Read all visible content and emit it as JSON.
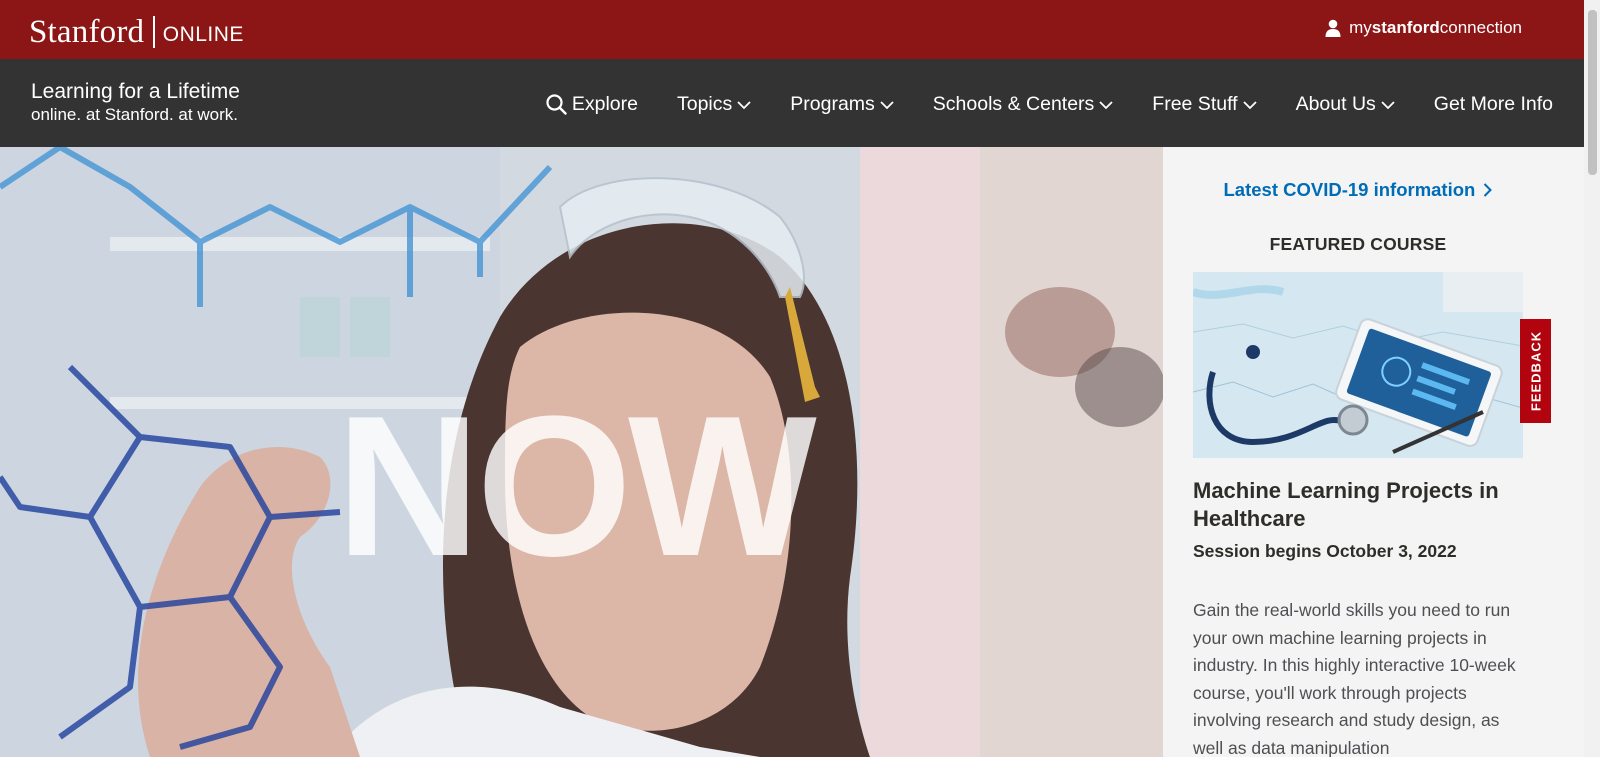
{
  "header": {
    "brand_name": "Stanford",
    "brand_suffix": "ONLINE",
    "account_link": {
      "prefix": "my",
      "bold": "stanford",
      "suffix": "connection",
      "icon": "user-icon"
    },
    "colors": {
      "cardinal": "#8c1515",
      "nav_bg": "#333333"
    }
  },
  "nav": {
    "tagline_title": "Learning for a Lifetime",
    "tagline_sub": "online. at Stanford. at work.",
    "items": [
      {
        "label": "Explore",
        "icon": "search-icon"
      },
      {
        "label": "Topics",
        "icon": "chevron-down-icon"
      },
      {
        "label": "Programs",
        "icon": "chevron-down-icon"
      },
      {
        "label": "Schools & Centers",
        "icon": "chevron-down-icon"
      },
      {
        "label": "Free Stuff",
        "icon": "chevron-down-icon"
      },
      {
        "label": "About Us",
        "icon": "chevron-down-icon"
      },
      {
        "label": "Get More Info"
      }
    ]
  },
  "hero": {
    "headline": "NOW"
  },
  "sidebar": {
    "covid_link": "Latest COVID-19 information",
    "featured_label": "FEATURED COURSE",
    "course": {
      "title": "Machine Learning Projects in Healthcare",
      "session": "Session begins October 3, 2022",
      "description": "Gain the real-world skills you need to run your own machine learning projects in industry. In this highly interactive 10-week course, you'll work through projects involving research and study design, as well as data manipulation"
    },
    "link_color": "#006cb8"
  },
  "feedback": {
    "label": "FEEDBACK",
    "color": "#b1040e"
  }
}
